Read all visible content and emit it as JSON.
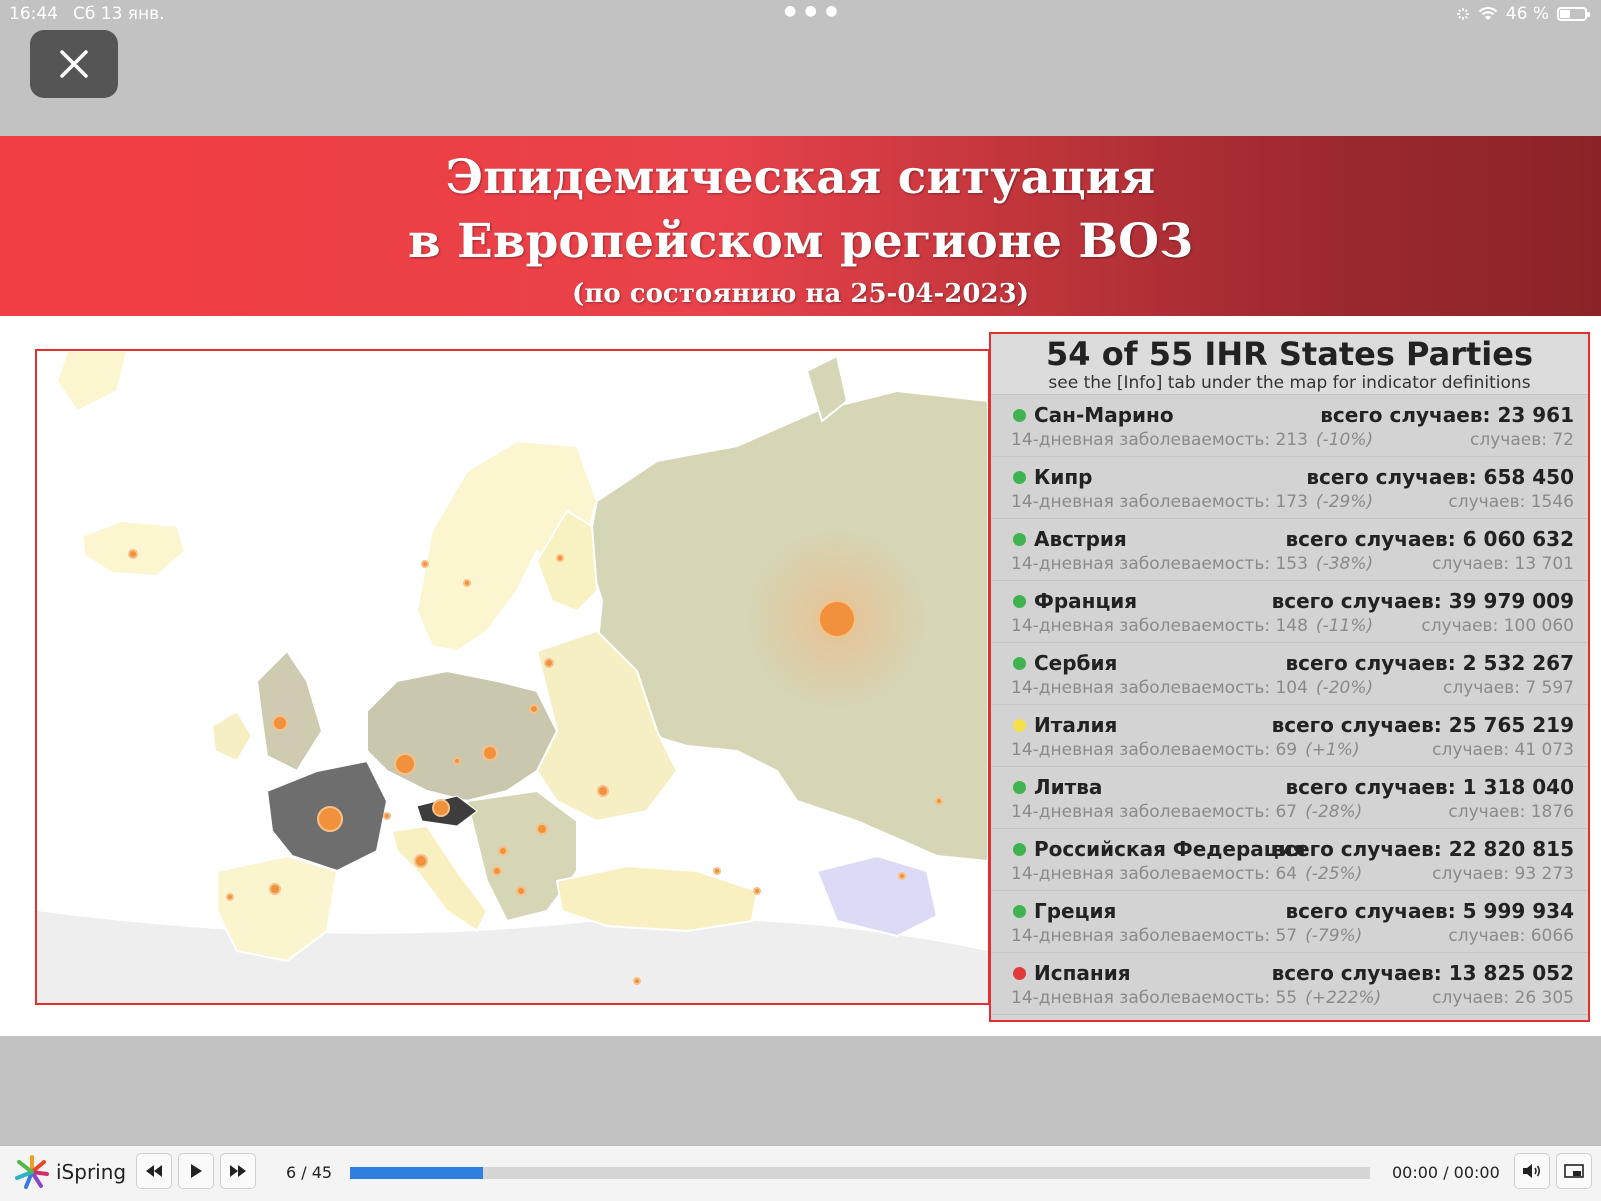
{
  "status_bar": {
    "time": "16:44",
    "date": "Сб 13 янв.",
    "battery": "46 %",
    "battery_level": 0.46
  },
  "slide": {
    "title_line1": "Эпидемическая ситуация",
    "title_line2": "в Европейском регионе ВОЗ",
    "subtitle": "(по состоянию на 25-04-2023)"
  },
  "panel": {
    "title": "54 of 55 IHR States Parties",
    "subtitle": "see the [Info] tab under the map for indicator definitions",
    "rows": [
      {
        "status": "green",
        "name": "Сан-Марино",
        "total": "всего случаев: 23 961",
        "incidence": "14-дневная заболеваемость: 213",
        "change": "(-10%)",
        "cases": "случаев: 72"
      },
      {
        "status": "green",
        "name": "Кипр",
        "total": "всего случаев: 658 450",
        "incidence": "14-дневная заболеваемость: 173",
        "change": "(-29%)",
        "cases": "случаев: 1546"
      },
      {
        "status": "green",
        "name": "Австрия",
        "total": "всего случаев: 6 060 632",
        "incidence": "14-дневная заболеваемость: 153",
        "change": "(-38%)",
        "cases": "случаев: 13 701"
      },
      {
        "status": "green",
        "name": "Франция",
        "total": "всего случаев: 39 979 009",
        "incidence": "14-дневная заболеваемость: 148",
        "change": "(-11%)",
        "cases": "случаев: 100 060"
      },
      {
        "status": "green",
        "name": "Сербия",
        "total": "всего случаев: 2 532 267",
        "incidence": "14-дневная заболеваемость: 104",
        "change": "(-20%)",
        "cases": "случаев: 7 597"
      },
      {
        "status": "yellow",
        "name": "Италия",
        "total": "всего случаев: 25 765 219",
        "incidence": "14-дневная заболеваемость: 69",
        "change": "(+1%)",
        "cases": "случаев: 41 073"
      },
      {
        "status": "green",
        "name": "Литва",
        "total": "всего случаев: 1 318 040",
        "incidence": "14-дневная заболеваемость: 67",
        "change": "(-28%)",
        "cases": "случаев: 1876"
      },
      {
        "status": "green",
        "name": "Российская Федерация",
        "total": "всего случаев: 22 820 815",
        "incidence": "14-дневная заболеваемость: 64",
        "change": "(-25%)",
        "cases": "случаев: 93 273"
      },
      {
        "status": "green",
        "name": "Греция",
        "total": "всего случаев: 5 999 934",
        "incidence": "14-дневная заболеваемость: 57",
        "change": "(-79%)",
        "cases": "случаев: 6066"
      },
      {
        "status": "red",
        "name": "Испания",
        "total": "всего случаев: 13 825 052",
        "incidence": "14-дневная заболеваемость: 55",
        "change": "(+222%)",
        "cases": "случаев: 26 305"
      }
    ]
  },
  "colors": {
    "green": "#3fb34f",
    "yellow": "#f5e04a",
    "red": "#e03a3a",
    "accent": "#2f7fe0"
  },
  "player": {
    "brand": "iSpring",
    "current_slide": 6,
    "total_slides": 45,
    "page_indicator": "6 / 45",
    "time": "00:00 / 00:00",
    "progress_fraction": 0.13
  },
  "icons": {
    "close": "close-icon",
    "rewind": "rewind-icon",
    "play": "play-icon",
    "forward": "fast-forward-icon",
    "volume": "volume-icon",
    "fullscreen": "fullscreen-icon",
    "logo": "ispring-logo-icon"
  }
}
